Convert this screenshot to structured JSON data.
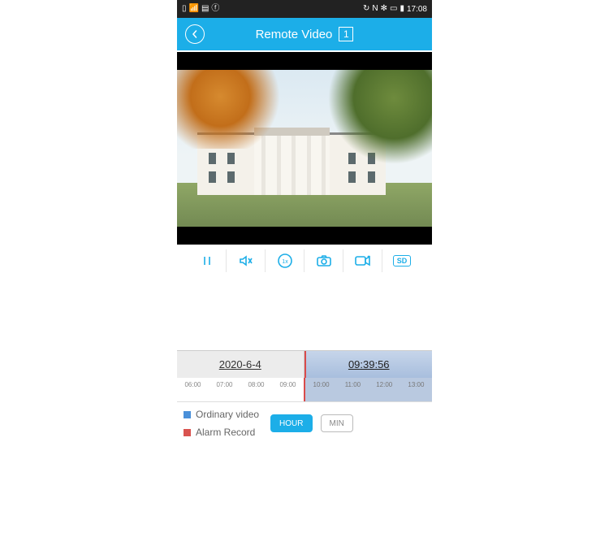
{
  "status_bar": {
    "left_icons": [
      "HD",
      "signal",
      "wifi",
      "facebook"
    ],
    "right_icons": [
      "loop",
      "nfc",
      "bluetooth",
      "vibrate",
      "battery"
    ],
    "time": "17:08"
  },
  "header": {
    "title": "Remote Video",
    "camera_count": "1"
  },
  "controls": {
    "pause": "pause-icon",
    "mute": "mute-icon",
    "speed": "1x",
    "snapshot": "camera-icon",
    "record": "video-record-icon",
    "quality": "SD"
  },
  "timeline": {
    "date": "2020-6-4",
    "time": "09:39:56",
    "ticks_left": [
      "06:00",
      "07:00",
      "08:00",
      "09:00"
    ],
    "ticks_right": [
      "10:00",
      "11:00",
      "12:00",
      "13:00"
    ]
  },
  "legend": {
    "ordinary": "Ordinary video",
    "alarm": "Alarm Record"
  },
  "scale": {
    "hour": "HOUR",
    "min": "MIN",
    "active": "hour"
  }
}
